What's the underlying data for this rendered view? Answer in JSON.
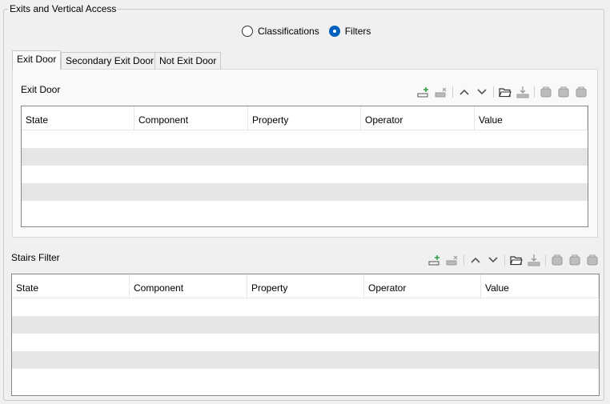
{
  "group": {
    "title": "Exits and Vertical Access"
  },
  "mode": {
    "options": [
      {
        "label": "Classifications",
        "checked": false
      },
      {
        "label": "Filters",
        "checked": true
      }
    ]
  },
  "tabs": [
    {
      "label": "Exit Door",
      "active": true
    },
    {
      "label": "Secondary Exit Door",
      "active": false
    },
    {
      "label": "Not Exit Door",
      "active": false
    }
  ],
  "exit_door": {
    "title": "Exit Door",
    "columns": [
      "State",
      "Component",
      "Property",
      "Operator",
      "Value"
    ]
  },
  "stairs": {
    "title": "Stairs Filter",
    "columns": [
      "State",
      "Component",
      "Property",
      "Operator",
      "Value"
    ]
  },
  "toolbar_icons": [
    "add-row-icon",
    "delete-row-icon",
    "move-up-icon",
    "move-down-icon",
    "open-folder-icon",
    "download-icon",
    "bag-icon",
    "bag-icon",
    "bag-icon"
  ],
  "colors": {
    "radio_selected": "#0060c0",
    "alt_row": "#e6e6e6"
  }
}
